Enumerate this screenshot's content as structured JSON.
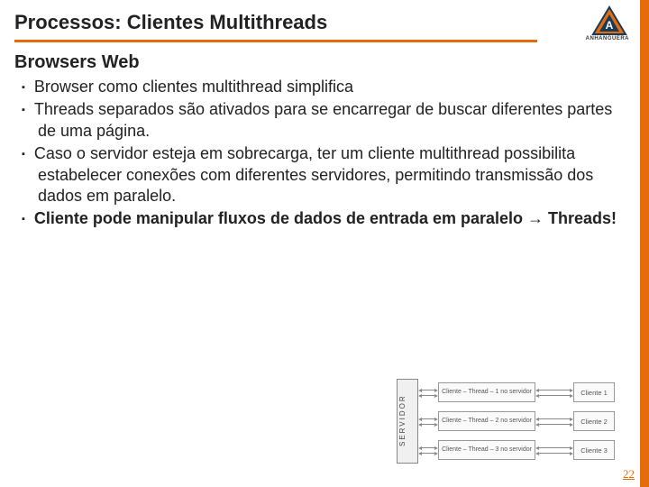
{
  "brand": "ANHANGUERA",
  "title": "Processos: Clientes Multithreads",
  "section_heading": "Browsers Web",
  "bullets": [
    {
      "text": "Browser como clientes multithread simplifica",
      "bold": false
    },
    {
      "text": "Threads separados são ativados para se encarregar de buscar diferentes partes de uma página.",
      "bold": false
    },
    {
      "text": "Caso o servidor esteja em sobrecarga, ter um cliente multithread possibilita estabelecer conexões com diferentes servidores, permitindo transmissão dos dados em paralelo.",
      "bold": false
    },
    {
      "text": "Cliente pode manipular fluxos de dados de entrada em paralelo → Threads!",
      "bold": true
    }
  ],
  "diagram": {
    "server": "SERVIDOR",
    "threads": [
      "Cliente – Thread – 1 no servidor",
      "Cliente – Thread – 2 no servidor",
      "Cliente – Thread – 3 no servidor"
    ],
    "clients": [
      "Cliente 1",
      "Cliente 2",
      "Cliente 3"
    ]
  },
  "page_number": "22",
  "accent_color": "#e46c0a"
}
